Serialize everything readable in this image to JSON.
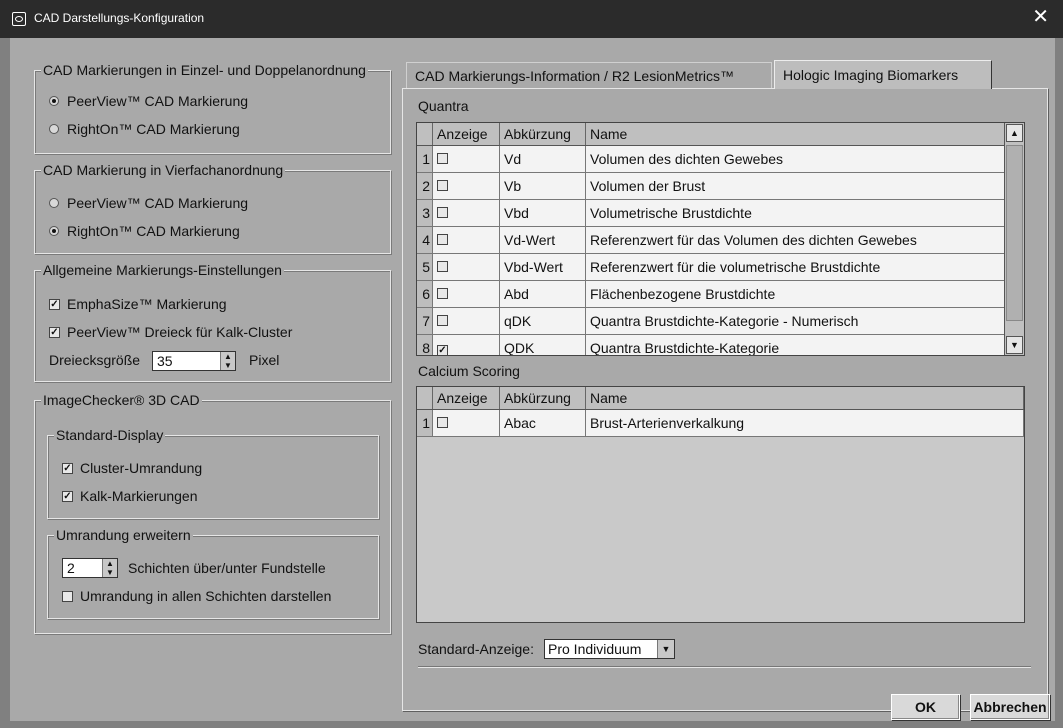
{
  "window": {
    "title": "CAD Darstellungs-Konfiguration",
    "close_glyph": "✕"
  },
  "group_single_double": {
    "title": "CAD Markierungen in Einzel- und Doppelanordnung",
    "options": [
      {
        "label": "PeerView™ CAD Markierung",
        "selected": true
      },
      {
        "label": "RightOn™ CAD Markierung",
        "selected": false
      }
    ]
  },
  "group_quad": {
    "title": "CAD Markierung in Vierfachanordnung",
    "options": [
      {
        "label": "PeerView™ CAD Markierung",
        "selected": false
      },
      {
        "label": "RightOn™ CAD Markierung",
        "selected": true
      }
    ]
  },
  "group_general": {
    "title": "Allgemeine Markierungs-Einstellungen",
    "emphasize": {
      "label": "EmphaSize™ Markierung",
      "checked": true,
      "mark": "☑"
    },
    "triangle": {
      "label": "PeerView™ Dreieck für Kalk-Cluster",
      "checked": true,
      "mark": "☑"
    },
    "triangle_size_label": "Dreiecksgröße",
    "triangle_size_value": "35",
    "triangle_size_unit": "Pixel"
  },
  "group_imagechecker": {
    "title": "ImageChecker® 3D CAD",
    "standard_display": {
      "title": "Standard-Display",
      "cluster": {
        "label": "Cluster-Umrandung",
        "checked": true
      },
      "calc": {
        "label": "Kalk-Markierungen",
        "checked": true
      }
    },
    "extend": {
      "title": "Umrandung erweitern",
      "layers_value": "2",
      "layers_label": "Schichten über/unter Fundstelle",
      "all_layers": {
        "label": "Umrandung in allen Schichten darstellen",
        "checked": false
      }
    }
  },
  "tabs": [
    {
      "label": "CAD Markierungs-Information / R2 LesionMetrics™",
      "active": false
    },
    {
      "label": "Hologic Imaging Biomarkers",
      "active": true
    }
  ],
  "quantra": {
    "title": "Quantra",
    "headers": [
      "Anzeige",
      "Abkürzung",
      "Name"
    ],
    "rows": [
      {
        "n": "1",
        "checked": false,
        "abbr": "Vd",
        "name": "Volumen des dichten Gewebes"
      },
      {
        "n": "2",
        "checked": false,
        "abbr": "Vb",
        "name": "Volumen der Brust"
      },
      {
        "n": "3",
        "checked": false,
        "abbr": "Vbd",
        "name": "Volumetrische Brustdichte"
      },
      {
        "n": "4",
        "checked": false,
        "abbr": "Vd-Wert",
        "name": "Referenzwert für das Volumen des dichten Gewebes"
      },
      {
        "n": "5",
        "checked": false,
        "abbr": "Vbd-Wert",
        "name": "Referenzwert für die volumetrische Brustdichte"
      },
      {
        "n": "6",
        "checked": false,
        "abbr": "Abd",
        "name": "Flächenbezogene Brustdichte"
      },
      {
        "n": "7",
        "checked": false,
        "abbr": "qDK",
        "name": "Quantra Brustdichte-Kategorie - Numerisch"
      },
      {
        "n": "8",
        "checked": true,
        "abbr": "QDK",
        "name": "Quantra Brustdichte-Kategorie"
      }
    ]
  },
  "calcium": {
    "title": "Calcium Scoring",
    "headers": [
      "Anzeige",
      "Abkürzung",
      "Name"
    ],
    "rows": [
      {
        "n": "1",
        "checked": false,
        "abbr": "Abac",
        "name": "Brust-Arterienverkalkung"
      }
    ]
  },
  "default_view": {
    "label": "Standard-Anzeige:",
    "value": "Pro Individuum"
  },
  "buttons": {
    "ok": "OK",
    "cancel": "Abbrechen"
  }
}
